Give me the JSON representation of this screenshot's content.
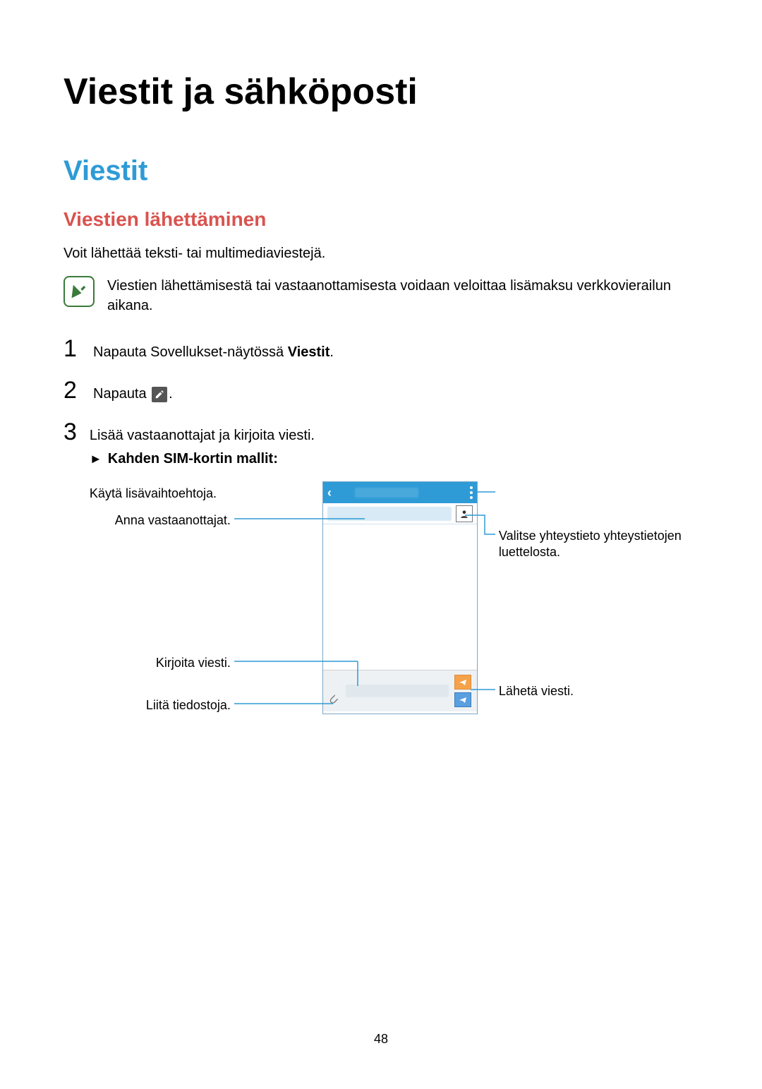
{
  "page_number": "48",
  "heading": "Viestit ja sähköposti",
  "section": "Viestit",
  "subsection": "Viestien lähettäminen",
  "intro": "Voit lähettää teksti- tai multimediaviestejä.",
  "note": "Viestien lähettämisestä tai vastaanottamisesta voidaan veloittaa lisämaksu verkkovierailun aikana.",
  "steps": {
    "s1_pre": "Napauta Sovellukset-näytössä ",
    "s1_bold": "Viestit",
    "s1_post": ".",
    "s2_pre": "Napauta ",
    "s2_post": ".",
    "s3": "Lisää vastaanottajat ja kirjoita viesti."
  },
  "bullet": {
    "arrow": "►",
    "text": "Kahden SIM-kortin mallit",
    "colon": ":"
  },
  "callouts": {
    "recipients": "Anna vastaanottajat.",
    "write": "Kirjoita viesti.",
    "attach": "Liitä tiedostoja.",
    "options": "Käytä lisävaihtoehtoja.",
    "contacts": "Valitse yhteystieto yhteystietojen luettelosta.",
    "send": "Lähetä viesti."
  }
}
